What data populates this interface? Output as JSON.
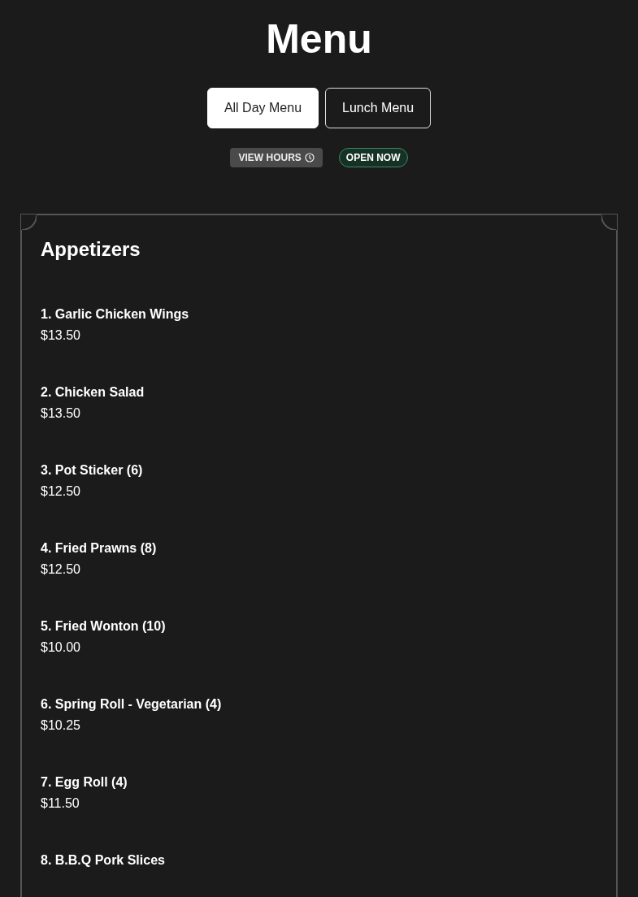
{
  "title": "Menu",
  "tabs": [
    {
      "label": "All Day Menu",
      "selected": true
    },
    {
      "label": "Lunch Menu",
      "selected": false
    }
  ],
  "hours_button": "VIEW HOURS",
  "status": {
    "label": "OPEN NOW",
    "open": true
  },
  "section": {
    "title": "Appetizers",
    "items": [
      {
        "name": "1. Garlic Chicken Wings",
        "price": "$13.50"
      },
      {
        "name": "2. Chicken Salad",
        "price": "$13.50"
      },
      {
        "name": "3. Pot Sticker (6)",
        "price": "$12.50"
      },
      {
        "name": "4. Fried Prawns (8)",
        "price": "$12.50"
      },
      {
        "name": "5. Fried Wonton (10)",
        "price": "$10.00"
      },
      {
        "name": "6. Spring Roll - Vegetarian (4)",
        "price": "$10.25"
      },
      {
        "name": "7. Egg Roll (4)",
        "price": "$11.50"
      },
      {
        "name": "8. B.B.Q Pork Slices"
      }
    ]
  }
}
